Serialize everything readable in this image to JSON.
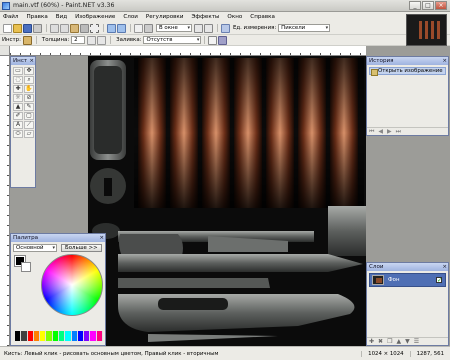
{
  "window": {
    "title": "main.vtf (60%) - Paint.NET v3.36",
    "buttons": [
      "_",
      "□",
      "×"
    ]
  },
  "menu": [
    "Файл",
    "Правка",
    "Вид",
    "Изображение",
    "Слои",
    "Регулировки",
    "Эффекты",
    "Окно",
    "Справка"
  ],
  "toolbar2": {
    "zoom_value": "В окне",
    "units_label": "Ед. измерения:",
    "units_value": "Пиксели"
  },
  "toolbar3": {
    "tool_label": "Инстр:",
    "width_label": "Толщина:",
    "width_value": "2",
    "fill_label": "Заливка:",
    "fill_value": "Отсутств"
  },
  "tools_panel": {
    "title": "Инст",
    "icons": [
      "▭",
      "✥",
      "◌",
      "⌕",
      "✚",
      "✋",
      "☼",
      "⊘",
      "▲",
      "✎",
      "✐",
      "▢",
      "A",
      "⟋",
      "⬭",
      "▱"
    ]
  },
  "history_panel": {
    "title": "История",
    "items": [
      "Открыть изображение"
    ]
  },
  "layers_panel": {
    "title": "Слои",
    "items": [
      {
        "name": "Фон",
        "visible": "✓"
      }
    ]
  },
  "palette_panel": {
    "title": "Палитра",
    "mode_value": "Основной",
    "more_button": "Больше >>",
    "swatches": [
      "#000000",
      "#404040",
      "#ff0000",
      "#ff8000",
      "#ffff00",
      "#80ff00",
      "#00ff00",
      "#00ff80",
      "#00ffff",
      "#0080ff",
      "#0000ff",
      "#8000ff",
      "#ff00ff",
      "#ff0080"
    ]
  },
  "status": {
    "text": "Кисть: Левый клик - рисовать основным цветом, Правый клик - вторичным",
    "size": "1024 × 1024",
    "position": "1287, 561"
  },
  "colors": {
    "accent": "#4f6fb4",
    "canvas_bg": "#111111",
    "copper": "#9a4a2a"
  }
}
